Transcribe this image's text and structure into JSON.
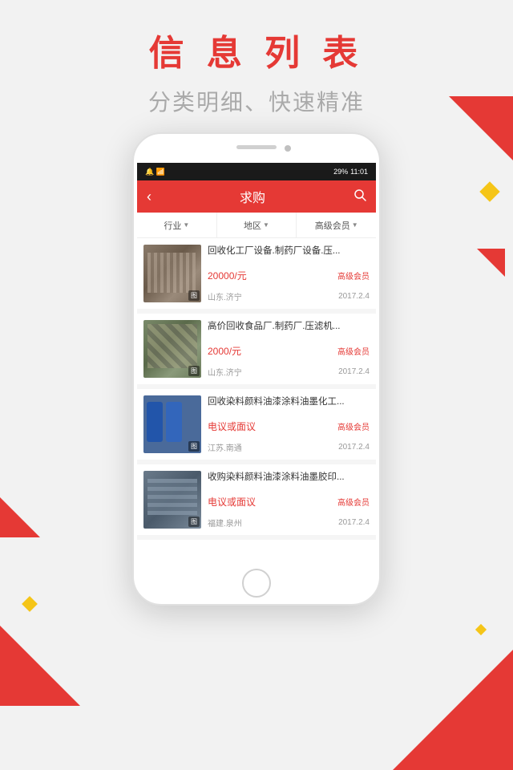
{
  "header": {
    "main_title": "信 息 列 表",
    "sub_title": "分类明细、快速精准"
  },
  "app": {
    "status_bar": {
      "left": "🔔  📶",
      "signal": "📶",
      "battery": "29%",
      "time": "11:01"
    },
    "toolbar": {
      "back_label": "‹",
      "title": "求购",
      "search_icon": "🔍"
    },
    "filters": [
      {
        "label": "行业",
        "arrow": "▼"
      },
      {
        "label": "地区",
        "arrow": "▼"
      },
      {
        "label": "高级会员",
        "arrow": "▼"
      }
    ],
    "items": [
      {
        "title": "回收化工厂设备.制药厂设备.压...",
        "price": "20000/元",
        "badge": "高级会员",
        "location": "山东.济宁",
        "date": "2017.2.4",
        "img_label": "图"
      },
      {
        "title": "高价回收食品厂.制药厂.压滤机...",
        "price": "2000/元",
        "badge": "高级会员",
        "location": "山东.济宁",
        "date": "2017.2.4",
        "img_label": "图"
      },
      {
        "title": "回收染料颜料油漆涂料油墨化工...",
        "price": "电议或面议",
        "badge": "高级会员",
        "location": "江苏.南通",
        "date": "2017.2.4",
        "img_label": "图"
      },
      {
        "title": "收购染料颜料油漆涂料油墨胶印...",
        "price": "电议或面议",
        "badge": "高级会员",
        "location": "福建.泉州",
        "date": "2017.2.4",
        "img_label": "图"
      }
    ]
  }
}
